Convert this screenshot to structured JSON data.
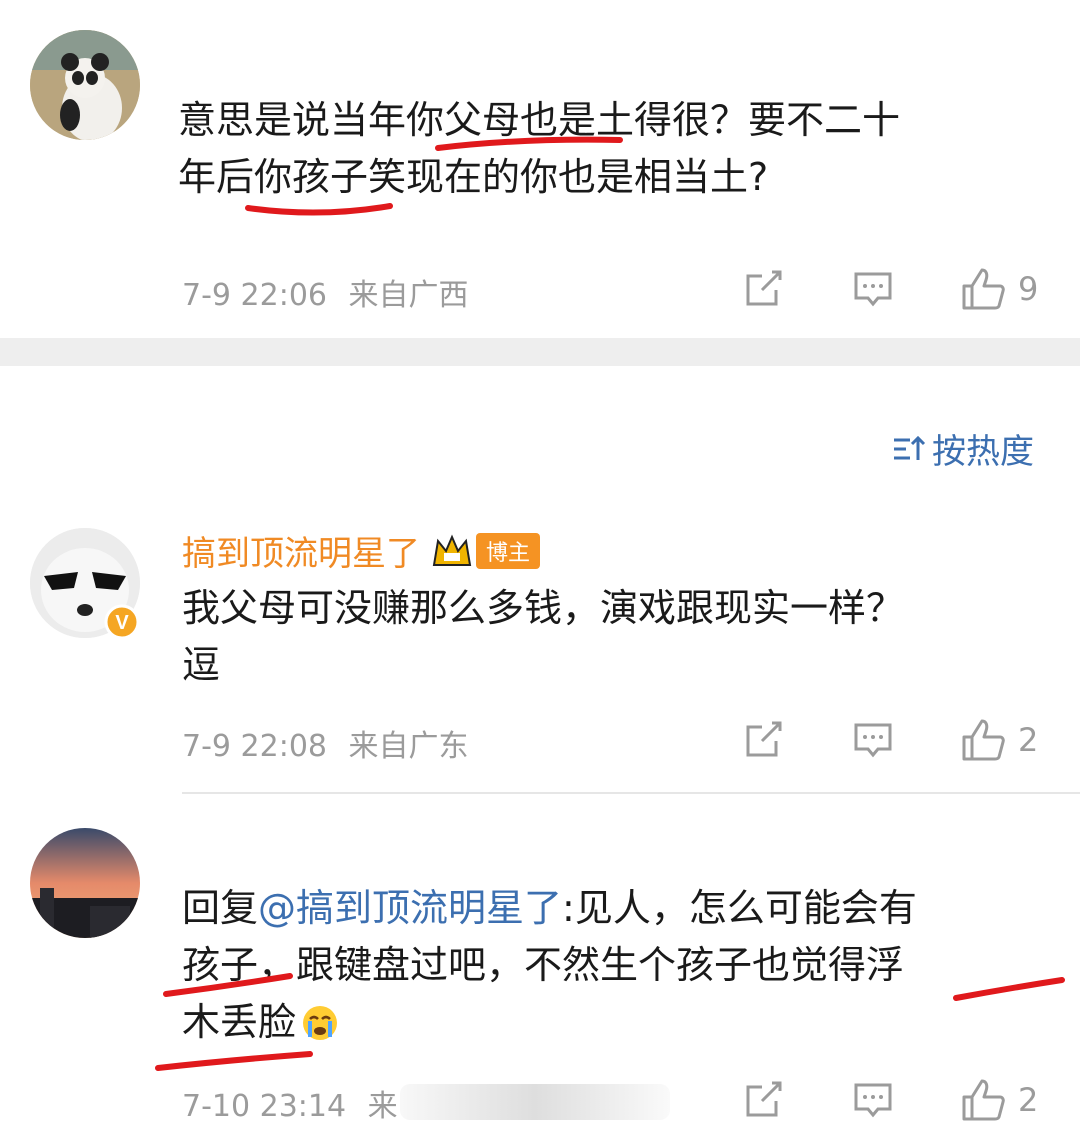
{
  "comments": [
    {
      "username": "",
      "text_line1": "意思是说当年你父母也是土得很？要不二十",
      "text_line2": "年后你孩子笑现在的你也是相当土?",
      "time": "7-9 22:06",
      "location": "来自广西",
      "likes": "9"
    },
    {
      "username": "搞到顶流明星了",
      "badge": "博主",
      "text_line1": "我父母可没赚那么多钱，演戏跟现实一样？",
      "text_line2": "逗",
      "time": "7-9 22:08",
      "location": "来自广东",
      "likes": "2"
    },
    {
      "username": "",
      "reply_prefix": "回复",
      "mention": "@搞到顶流明星了",
      "text_line1_rest": ":见人，怎么可能会有",
      "text_line2": "孩子，跟键盘过吧，不然生个孩子也觉得浮",
      "text_line3": "木丢脸",
      "time": "7-10 23:14",
      "location": "来",
      "likes": "2"
    }
  ],
  "sort_label": "按热度",
  "colors": {
    "username": "#f08a24",
    "mention": "#3c6fb0",
    "meta": "#9b9b9b",
    "annotation": "#e0191c"
  },
  "icons": [
    "share-icon",
    "comment-icon",
    "like-icon",
    "sort-icon",
    "crown-icon",
    "verified-icon",
    "crying-emoji-icon"
  ]
}
